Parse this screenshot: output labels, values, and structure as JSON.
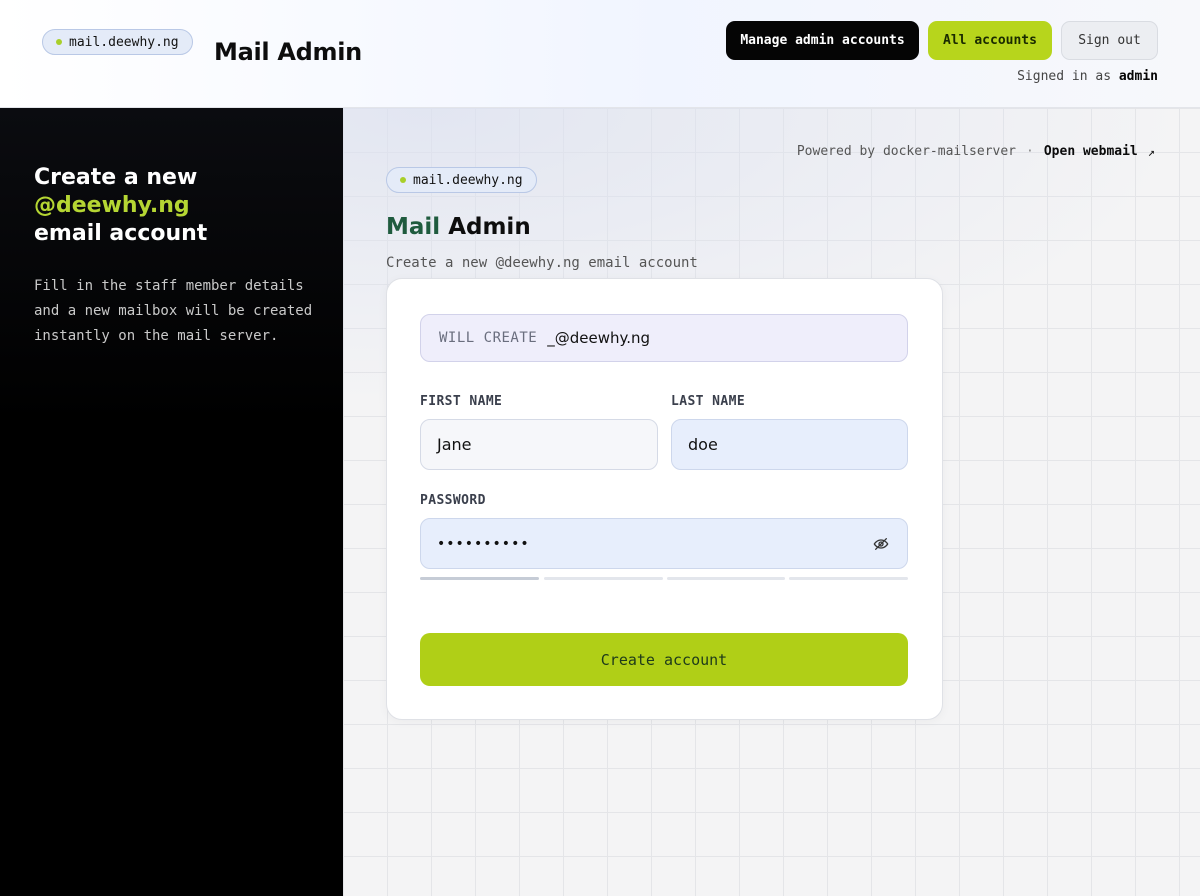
{
  "header": {
    "domain_chip": "mail.deewhy.ng",
    "title": "Mail Admin",
    "buttons": {
      "manage": "Manage admin accounts",
      "all": "All accounts",
      "signout": "Sign out"
    },
    "signed_in_prefix": "Signed in as",
    "signed_in_user": "admin"
  },
  "left_panel": {
    "heading_line1": "Create a new",
    "heading_accent": "@deewhy.ng",
    "heading_line3": "email account",
    "description": "Fill in the staff member details and a new mailbox will be created instantly on the mail server."
  },
  "main": {
    "powered_by": "Powered by docker-mailserver",
    "separator": "·",
    "open_webmail": "Open webmail",
    "open_webmail_arrow": "↗",
    "domain_chip": "mail.deewhy.ng",
    "title_part1": "Mail",
    "title_part2": "Admin",
    "subtitle": "Create a new @deewhy.ng email account"
  },
  "form": {
    "will_create_label": "WILL CREATE",
    "will_create_value": "_@deewhy.ng",
    "first_name_label": "FIRST NAME",
    "first_name_value": "Jane",
    "last_name_label": "LAST NAME",
    "last_name_value": "doe",
    "password_label": "PASSWORD",
    "password_value": "••••••••••",
    "password_strength_filled": 1,
    "password_strength_total": 4,
    "submit_label": "Create account"
  },
  "colors": {
    "accent_green": "#b0cf17",
    "dark": "#050505",
    "brand_green_text": "#1f5b3e"
  }
}
